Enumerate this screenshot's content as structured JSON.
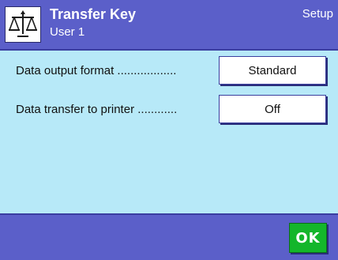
{
  "header": {
    "title": "Transfer Key",
    "subtitle": "User 1",
    "context": "Setup",
    "icon": "balance-scale-icon"
  },
  "settings": {
    "rows": [
      {
        "label": "Data output format",
        "dots": "..................",
        "value": "Standard"
      },
      {
        "label": "Data transfer to printer",
        "dots": "............",
        "value": "Off"
      }
    ]
  },
  "footer": {
    "ok_label": "OK"
  },
  "colors": {
    "header_bg": "#5b5fc9",
    "content_bg": "#b7e9f8",
    "ok_green": "#14b62b"
  }
}
